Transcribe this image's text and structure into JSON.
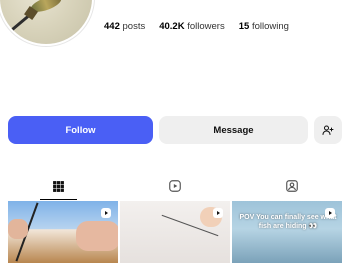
{
  "profile": {
    "stats": [
      {
        "value": "442",
        "label": "posts"
      },
      {
        "value": "40.2K",
        "label": "followers"
      },
      {
        "value": "15",
        "label": "following"
      }
    ]
  },
  "actions": {
    "follow_label": "Follow",
    "message_label": "Message",
    "add_icon": "person-add-icon"
  },
  "tabs": [
    {
      "icon": "grid-icon",
      "active": true
    },
    {
      "icon": "reels-icon",
      "active": false
    },
    {
      "icon": "tagged-icon",
      "active": false
    }
  ],
  "posts": [
    {
      "type": "reel",
      "caption": ""
    },
    {
      "type": "reel",
      "caption": ""
    },
    {
      "type": "reel",
      "caption": "POV You can finally see what fish are hiding 👀"
    }
  ],
  "colors": {
    "accent": "#4a5ff5",
    "secondary_button": "#efefef"
  }
}
